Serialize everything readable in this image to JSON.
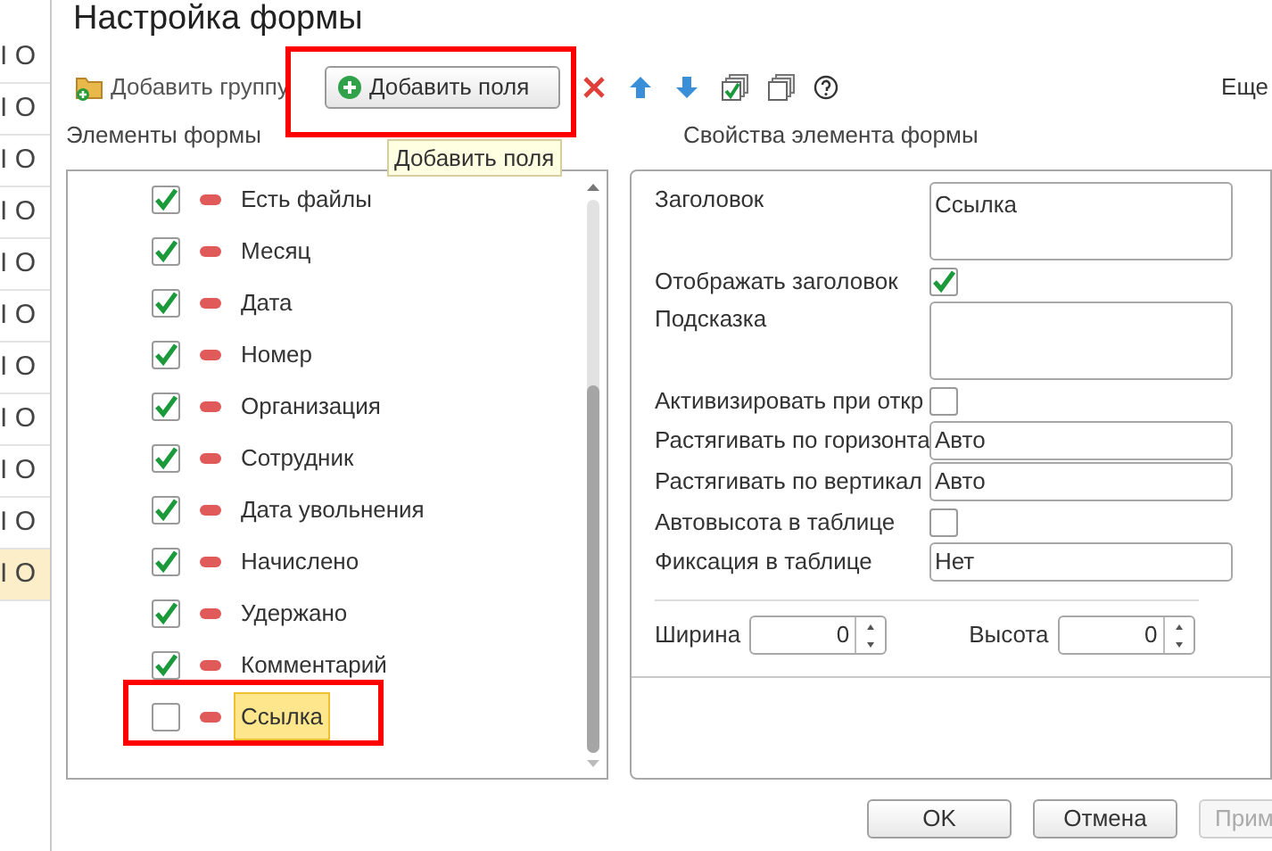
{
  "background_list": {
    "rows": [
      {
        "text": "I О",
        "selected": false
      },
      {
        "text": "I О",
        "selected": false
      },
      {
        "text": "I О",
        "selected": false
      },
      {
        "text": "I О",
        "selected": false
      },
      {
        "text": "I О",
        "selected": false
      },
      {
        "text": "I О",
        "selected": false
      },
      {
        "text": "I О",
        "selected": false
      },
      {
        "text": "I О",
        "selected": false
      },
      {
        "text": "I О",
        "selected": false
      },
      {
        "text": "I О",
        "selected": false
      },
      {
        "text": "I О",
        "selected": true
      }
    ]
  },
  "window": {
    "title": "Настройка формы"
  },
  "toolbar": {
    "add_group": "Добавить группу",
    "add_fields": "Добавить поля",
    "more": "Еще",
    "tooltip": "Добавить поля"
  },
  "elements_panel": {
    "title": "Элементы формы",
    "items": [
      {
        "label": "Есть файлы",
        "checked": true,
        "selected": false
      },
      {
        "label": "Месяц",
        "checked": true,
        "selected": false
      },
      {
        "label": "Дата",
        "checked": true,
        "selected": false
      },
      {
        "label": "Номер",
        "checked": true,
        "selected": false
      },
      {
        "label": "Организация",
        "checked": true,
        "selected": false
      },
      {
        "label": "Сотрудник",
        "checked": true,
        "selected": false
      },
      {
        "label": "Дата увольнения",
        "checked": true,
        "selected": false
      },
      {
        "label": "Начислено",
        "checked": true,
        "selected": false
      },
      {
        "label": "Удержано",
        "checked": true,
        "selected": false
      },
      {
        "label": "Комментарий",
        "checked": true,
        "selected": false
      },
      {
        "label": "Ссылка",
        "checked": false,
        "selected": true
      }
    ]
  },
  "properties_panel": {
    "title": "Свойства элемента формы",
    "rows": [
      {
        "kind": "textarea",
        "label": "Заголовок",
        "value": "Ссылка"
      },
      {
        "kind": "checkbox",
        "label": "Отображать заголовок",
        "checked": true
      },
      {
        "kind": "textarea",
        "label": "Подсказка"
      },
      {
        "kind": "checkbox",
        "label": "Активизировать при откр",
        "checked": false
      },
      {
        "kind": "field",
        "label": "Растягивать по горизонта",
        "value": "Авто"
      },
      {
        "kind": "field",
        "label": "Растягивать по вертикал",
        "value": "Авто"
      },
      {
        "kind": "checkbox",
        "label": "Автовысота в таблице",
        "checked": false
      },
      {
        "kind": "field",
        "label": "Фиксация в таблице",
        "value": "Нет"
      }
    ],
    "sizes": [
      {
        "label": "Ширина",
        "value": "0"
      },
      {
        "label": "Высота",
        "value": "0"
      }
    ]
  },
  "buttons": [
    {
      "label": "OK",
      "disabled": false
    },
    {
      "label": "Отмена",
      "disabled": false
    },
    {
      "label": "Прим",
      "disabled": true
    }
  ]
}
